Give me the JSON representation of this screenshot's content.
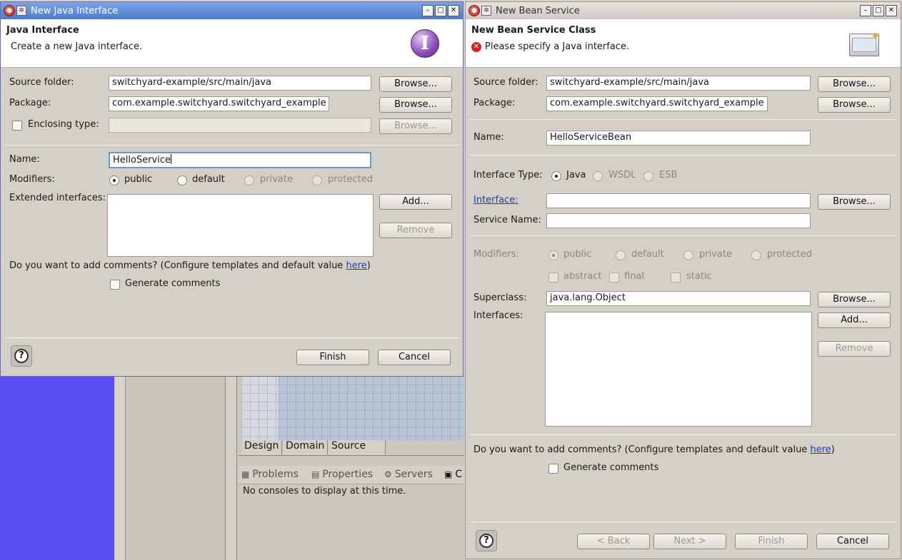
{
  "background": {
    "editor_tabs": [
      "Design",
      "Domain",
      "Source"
    ],
    "view_tabs": [
      "Problems",
      "Properties",
      "Servers",
      "C"
    ],
    "console_text": "No consoles to display at this time."
  },
  "left_dialog": {
    "window_title": "New Java Interface",
    "header_title": "Java Interface",
    "header_subtitle": "Create a new Java interface.",
    "source_folder_label": "Source folder:",
    "source_folder_value": "switchyard-example/src/main/java",
    "package_label": "Package:",
    "package_value": "com.example.switchyard.switchyard_example",
    "enclosing_type_label": "Enclosing type:",
    "browse_label": "Browse...",
    "name_label": "Name:",
    "name_value": "HelloService",
    "modifiers_label": "Modifiers:",
    "modifiers": [
      "public",
      "default",
      "private",
      "protected"
    ],
    "extended_interfaces_label": "Extended interfaces:",
    "add_label": "Add...",
    "remove_label": "Remove",
    "comments_text": "Do you want to add comments? (Configure templates and default value ",
    "comments_link": "here",
    "comments_close": ")",
    "generate_comments_label": "Generate comments",
    "finish_label": "Finish",
    "cancel_label": "Cancel",
    "help_label": "?"
  },
  "right_dialog": {
    "window_title": "New Bean Service",
    "header_title": "New Bean Service Class",
    "header_error": "Please specify a Java interface.",
    "source_folder_label": "Source folder:",
    "source_folder_value": "switchyard-example/src/main/java",
    "package_label": "Package:",
    "package_value": "com.example.switchyard.switchyard_example",
    "name_label": "Name:",
    "name_value": "HelloServiceBean",
    "interface_type_label": "Interface Type:",
    "interface_types": [
      "Java",
      "WSDL",
      "ESB"
    ],
    "interface_label": "Interface:",
    "service_name_label": "Service Name:",
    "modifiers_label": "Modifiers:",
    "modifiers": [
      "public",
      "default",
      "private",
      "protected"
    ],
    "extra_modifiers": [
      "abstract",
      "final",
      "static"
    ],
    "superclass_label": "Superclass:",
    "superclass_value": "java.lang.Object",
    "interfaces_label": "Interfaces:",
    "browse_label": "Browse...",
    "add_label": "Add...",
    "remove_label": "Remove",
    "comments_text": "Do you want to add comments? (Configure templates and default value ",
    "comments_link": "here",
    "comments_close": ")",
    "generate_comments_label": "Generate comments",
    "back_label": "< Back",
    "next_label": "Next >",
    "finish_label": "Finish",
    "cancel_label": "Cancel",
    "help_label": "?"
  },
  "colors": {
    "titlebar_active": "#4e7ccf",
    "desktop": "#5a4ef0",
    "error": "#d42020",
    "link": "#1b3fb0"
  }
}
